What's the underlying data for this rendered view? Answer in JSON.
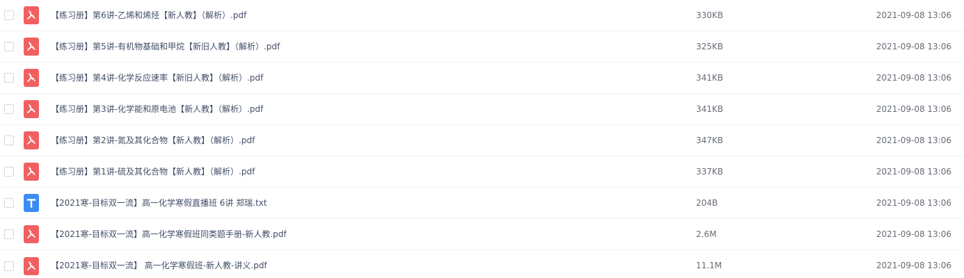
{
  "colors": {
    "pdf_icon": "#f16060",
    "txt_icon": "#3b8cf5",
    "name_text": "#424e67",
    "meta_text": "#666c75"
  },
  "files": [
    {
      "name": "【练习册】第6讲-乙烯和烯烃【新人教】（解析）.pdf",
      "size": "330KB",
      "date": "2021-09-08 13:06",
      "type": "pdf",
      "icon": "pdf-icon"
    },
    {
      "name": "【练习册】第5讲-有机物基础和甲烷【新旧人教】（解析）.pdf",
      "size": "325KB",
      "date": "2021-09-08 13:06",
      "type": "pdf",
      "icon": "pdf-icon"
    },
    {
      "name": "【练习册】第4讲-化学反应速率【新旧人教】（解析）.pdf",
      "size": "341KB",
      "date": "2021-09-08 13:06",
      "type": "pdf",
      "icon": "pdf-icon"
    },
    {
      "name": "【练习册】第3讲-化学能和原电池【新人教】（解析）.pdf",
      "size": "341KB",
      "date": "2021-09-08 13:06",
      "type": "pdf",
      "icon": "pdf-icon"
    },
    {
      "name": "【练习册】第2讲-氮及其化合物【新人教】（解析）.pdf",
      "size": "347KB",
      "date": "2021-09-08 13:06",
      "type": "pdf",
      "icon": "pdf-icon"
    },
    {
      "name": "【练习册】第1讲-硫及其化合物【新人教】（解析）.pdf",
      "size": "337KB",
      "date": "2021-09-08 13:06",
      "type": "pdf",
      "icon": "pdf-icon"
    },
    {
      "name": "【2021寒-目标双一流】高一化学寒假直播班 6讲 郑瑞.txt",
      "size": "204B",
      "date": "2021-09-08 13:06",
      "type": "txt",
      "icon": "txt-icon",
      "icon_glyph": "T"
    },
    {
      "name": "【2021寒-目标双一流】高一化学寒假班同类题手册-新人教.pdf",
      "size": "2.6M",
      "date": "2021-09-08 13:06",
      "type": "pdf",
      "icon": "pdf-icon"
    },
    {
      "name": "【2021寒-目标双一流】 高一化学寒假班-新人教-讲义.pdf",
      "size": "11.1M",
      "date": "2021-09-08 13:06",
      "type": "pdf",
      "icon": "pdf-icon"
    }
  ]
}
